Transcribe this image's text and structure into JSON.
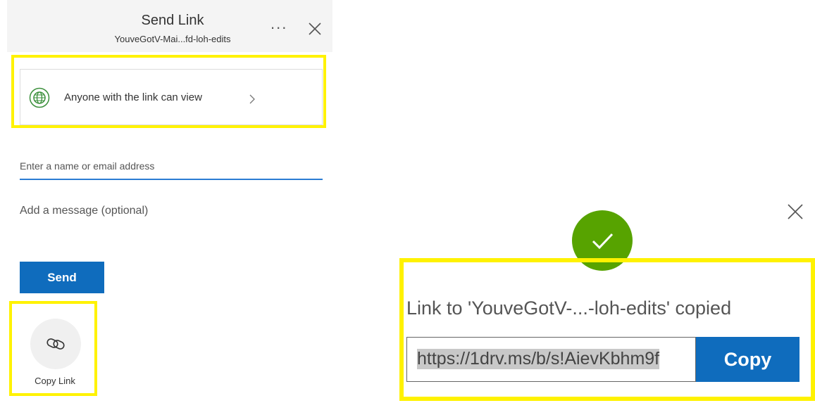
{
  "dialog": {
    "title": "Send Link",
    "subtitle": "YouveGotV-Mai...fd-loh-edits",
    "more_label": "...",
    "link_settings_label": "Anyone with the link can view",
    "recipient_placeholder": "Enter a name or email address",
    "message_placeholder": "Add a message (optional)",
    "send_label": "Send",
    "copy_link_label": "Copy Link"
  },
  "confirmation": {
    "message": "Link to 'YouveGotV-...-loh-edits' copied",
    "url": "https://1drv.ms/b/s!AievKbhm9f",
    "copy_label": "Copy"
  },
  "icons": {
    "globe": "globe-icon",
    "chevron": "chevron-right-icon",
    "link": "link-chain-icon",
    "check": "checkmark-icon",
    "close": "close-icon"
  },
  "colors": {
    "accent": "#0f6cbd",
    "highlight": "#fff200",
    "success": "#57a300",
    "globe": "#3a8f3a"
  }
}
